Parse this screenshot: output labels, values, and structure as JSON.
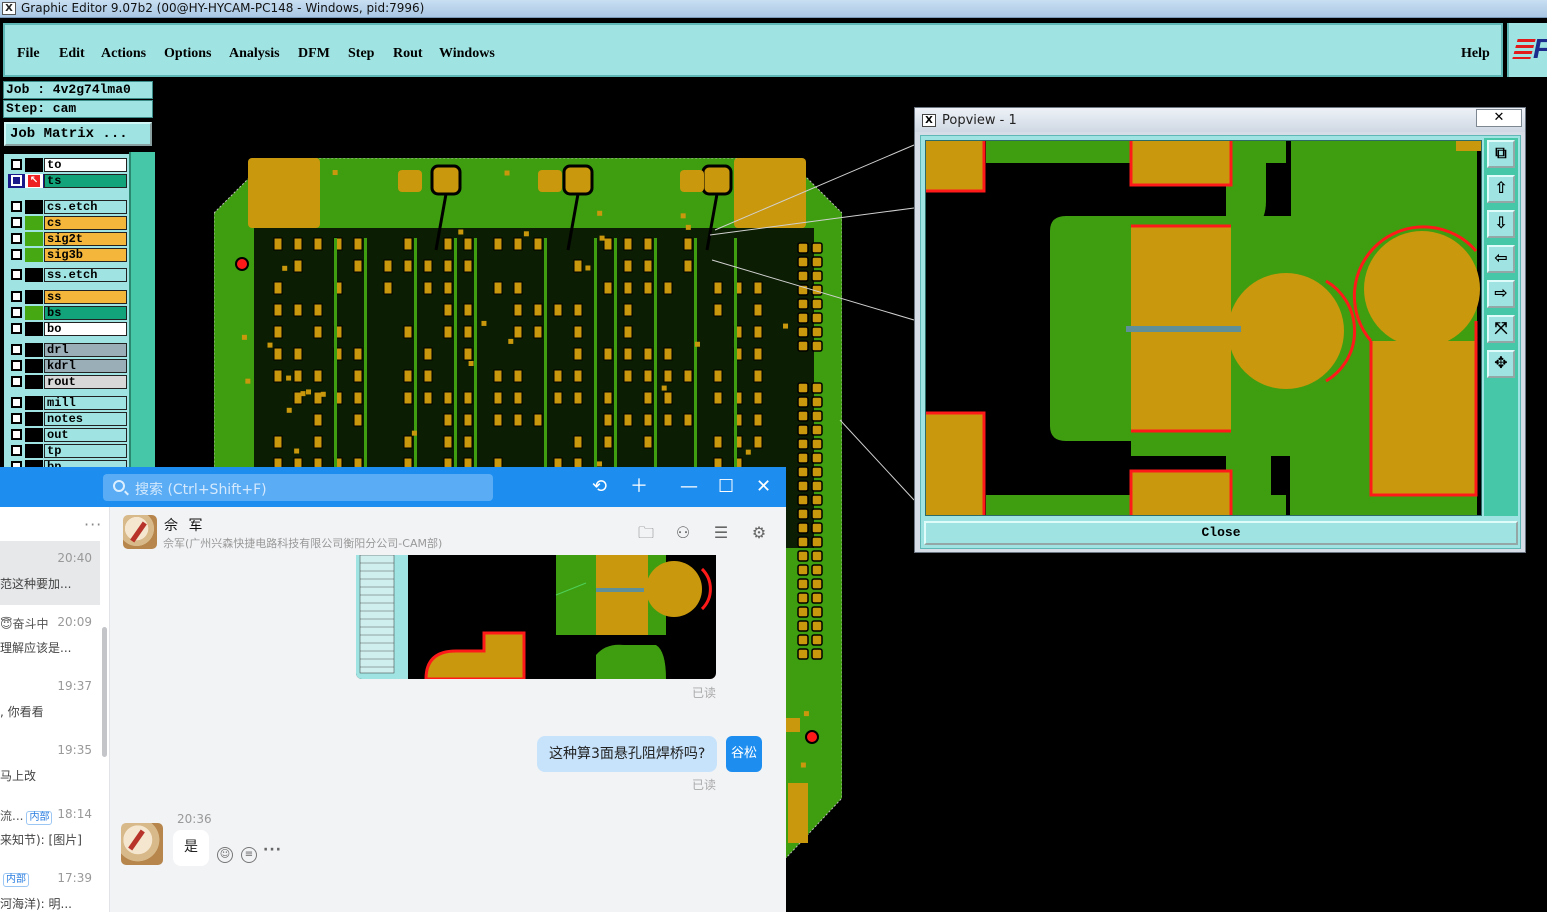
{
  "window": {
    "title": "Graphic Editor 9.07b2 (00@HY-HYCAM-PC148 - Windows, pid:7996)"
  },
  "menu": {
    "items": [
      "File",
      "Edit",
      "Actions",
      "Options",
      "Analysis",
      "DFM",
      "Step",
      "Rout",
      "Windows"
    ],
    "help": "Help"
  },
  "job": {
    "job_line": "Job : 4v2g74lma0",
    "step_line": "Step: cam",
    "matrix_button": "Job Matrix ..."
  },
  "layers": [
    {
      "name": "to",
      "color": "#ffffff"
    },
    {
      "name": "ts",
      "color": "#12a37a",
      "active": true
    },
    {
      "name": "cs.etch",
      "color": "#9fe4e2"
    },
    {
      "name": "cs",
      "color": "#f5b73b"
    },
    {
      "name": "sig2t",
      "color": "#f5b73b"
    },
    {
      "name": "sig3b",
      "color": "#f5b73b"
    },
    {
      "name": "ss.etch",
      "color": "#9fe4e2"
    },
    {
      "name": "ss",
      "color": "#f5b73b"
    },
    {
      "name": "bs",
      "color": "#12a37a"
    },
    {
      "name": "bo",
      "color": "#ffffff"
    },
    {
      "name": "drl",
      "color": "#9aaeb8"
    },
    {
      "name": "kdrl",
      "color": "#9aaeb8"
    },
    {
      "name": "rout",
      "color": "#d8d8d8"
    },
    {
      "name": "mill",
      "color": "#9fe4e2"
    },
    {
      "name": "notes",
      "color": "#9fe4e2"
    },
    {
      "name": "out",
      "color": "#9fe4e2"
    },
    {
      "name": "tp",
      "color": "#9fe4e2"
    },
    {
      "name": "bp",
      "color": "#9fe4e2"
    }
  ],
  "popview": {
    "title": "Popview - 1",
    "close_x": "✕",
    "close_button": "Close"
  },
  "colors": {
    "copper": "#c9980c",
    "mask": "#3f9e10",
    "board_bg": "#000000",
    "outline": "#ff1a1a",
    "ui_cyan": "#9fe4e2"
  },
  "chat": {
    "search_placeholder": "搜索 (Ctrl+Shift+F)",
    "contact_name": "佘 军",
    "contact_org": "佘军(广州兴森快捷电路科技有限公司衡阳分公司-CAM部)",
    "conversations": [
      {
        "time": "20:40",
        "who": "",
        "preview": "范这种要加...",
        "active": true
      },
      {
        "time": "20:09",
        "who": "😇奋斗中",
        "preview": "理解应该是..."
      },
      {
        "time": "19:37",
        "who": "",
        "preview": ", 你看看"
      },
      {
        "time": "19:35",
        "who": "",
        "preview": "马上改"
      },
      {
        "time": "18:14",
        "who": "流...",
        "tag": "内部",
        "preview": "来知节): [图片]"
      },
      {
        "time": "17:39",
        "who": "",
        "tag": "内部",
        "preview": "河海洋): 明..."
      }
    ],
    "read_label": "已读",
    "outgoing_message": "这种算3面悬孔阻焊桥吗?",
    "self_name": "谷松",
    "incoming_time": "20:36",
    "incoming_message": "是"
  }
}
